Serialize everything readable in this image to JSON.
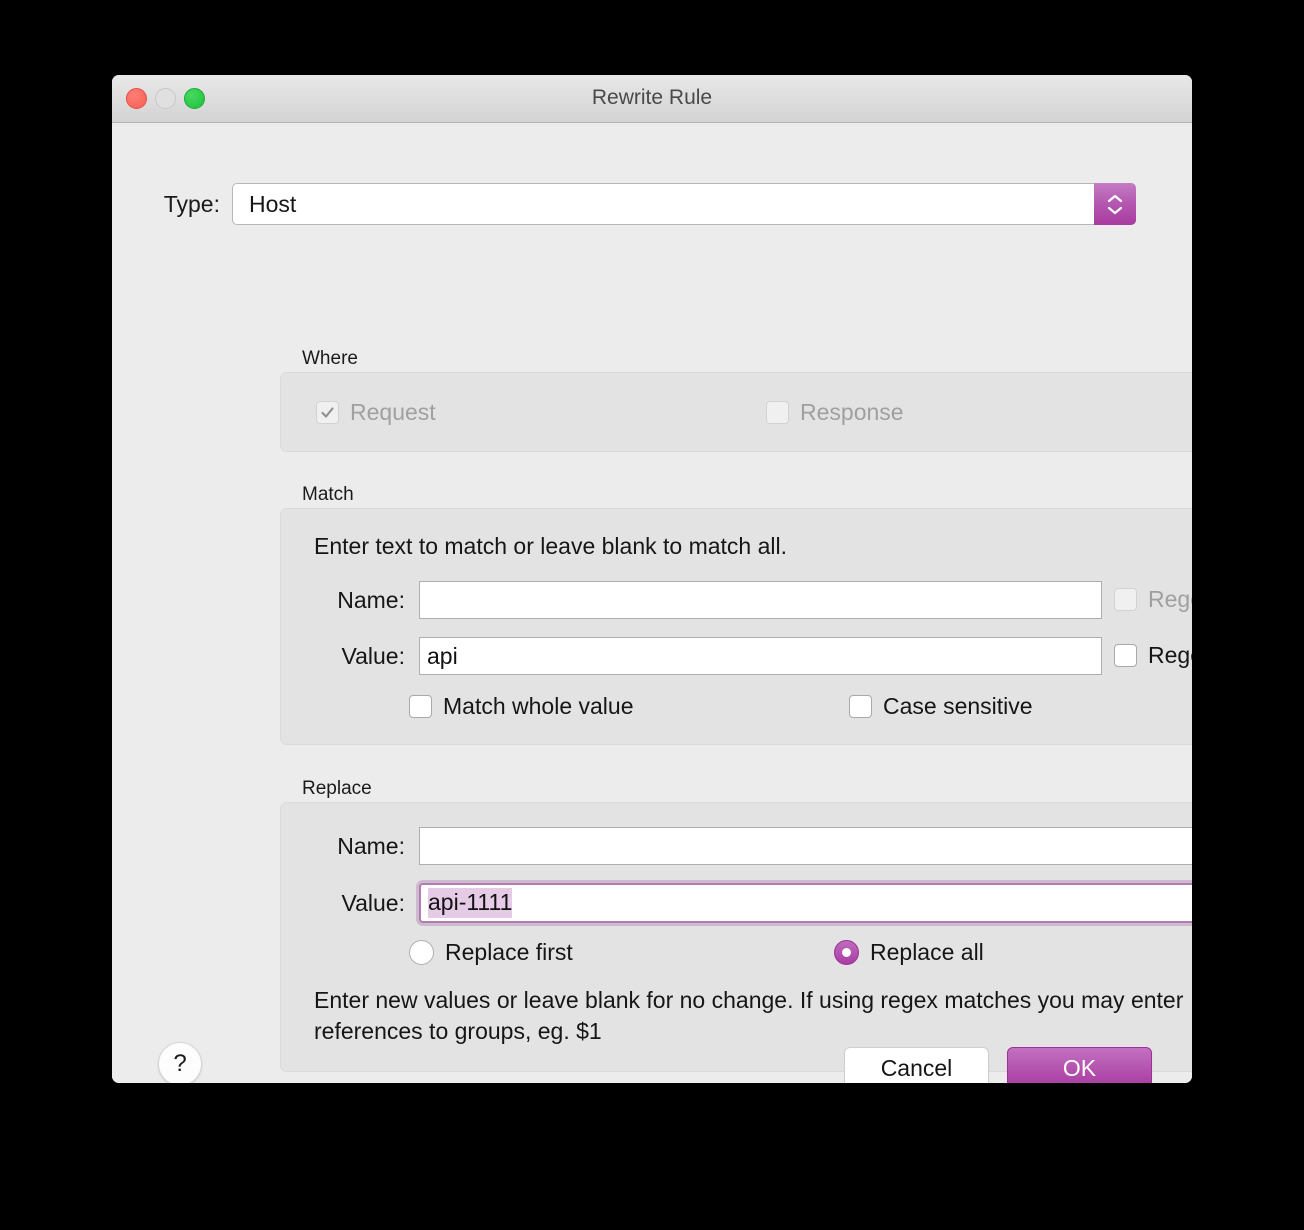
{
  "window": {
    "title": "Rewrite Rule",
    "controls": {
      "close": "close-button",
      "minimize": "minimize-button",
      "zoom": "zoom-button"
    }
  },
  "type": {
    "label": "Type:",
    "value": "Host",
    "options": [
      "Host"
    ]
  },
  "where": {
    "group_label": "Where",
    "request": {
      "label": "Request",
      "checked": true,
      "enabled": false
    },
    "response": {
      "label": "Response",
      "checked": false,
      "enabled": false
    }
  },
  "match": {
    "group_label": "Match",
    "hint": "Enter text to match or leave blank to match all.",
    "name": {
      "label": "Name:",
      "value": "",
      "placeholder": ""
    },
    "name_regex": {
      "label": "Regex",
      "checked": false,
      "enabled": false
    },
    "value": {
      "label": "Value:",
      "value": "api",
      "placeholder": ""
    },
    "value_regex": {
      "label": "Regex",
      "checked": false,
      "enabled": true
    },
    "whole_value": {
      "label": "Match whole value",
      "checked": false
    },
    "case_sensitive": {
      "label": "Case sensitive",
      "checked": false
    }
  },
  "replace": {
    "group_label": "Replace",
    "name": {
      "label": "Name:",
      "value": "",
      "placeholder": ""
    },
    "value": {
      "label": "Value:",
      "value": "api-1111",
      "placeholder": "",
      "selected": true,
      "focused": true
    },
    "replace_first": {
      "label": "Replace first",
      "selected": false
    },
    "replace_all": {
      "label": "Replace all",
      "selected": true
    },
    "hint": "Enter new values or leave blank for no change. If using regex matches you may enter references to groups, eg. $1"
  },
  "footer": {
    "help": "?",
    "cancel": "Cancel",
    "ok": "OK"
  },
  "colors": {
    "accent": "#a83ba0",
    "accent_light": "#c471c1",
    "selection": "#e6cbe6",
    "window_bg": "#ececec",
    "group_bg": "#e3e3e3"
  }
}
